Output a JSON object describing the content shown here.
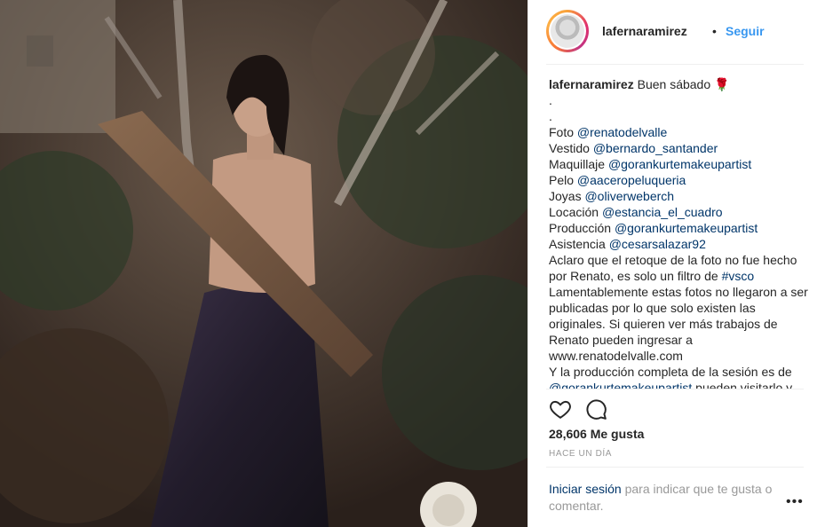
{
  "post": {
    "username": "lafernaramirez",
    "dot": "•",
    "follow_label": "Seguir",
    "caption_first": "Buen sábado 🌹",
    "caption_lines": [
      {
        "plain": ".",
        "mention": ""
      },
      {
        "plain": ".",
        "mention": ""
      },
      {
        "plain": "Foto ",
        "mention": "@renatodelvalle"
      },
      {
        "plain": "Vestido ",
        "mention": "@bernardo_santander"
      },
      {
        "plain": "Maquillaje ",
        "mention": "@gorankurtemakeupartist"
      },
      {
        "plain": "Pelo ",
        "mention": "@aaceropeluqueria"
      },
      {
        "plain": "Joyas ",
        "mention": "@oliverweberch"
      },
      {
        "plain": "Locación ",
        "mention": "@estancia_el_cuadro"
      },
      {
        "plain": "Producción ",
        "mention": "@gorankurtemakeupartist"
      },
      {
        "plain": "Asistencia ",
        "mention": "@cesarsalazar92"
      }
    ],
    "caption_para1": "Aclaro que el retoque de la foto no fue hecho por Renato, es solo un filtro de ",
    "caption_hashtag": "#vsco",
    "caption_para2": "Lamentablemente estas fotos no llegaron a ser publicadas por lo que solo existen las originales. Si quieren ver más trabajos de Renato pueden ingresar a www.renatodelvalle.com",
    "caption_para3": "Y la producción completa de la sesión es de ",
    "caption_para3_mention": "@gorankurtemakeupartist",
    "caption_para3_tail": " pueden visitarlo y",
    "likes": "28,606 Me gusta",
    "time": "HACE UN DÍA",
    "login_link": "Iniciar sesión",
    "login_text": " para indicar que te gusta o comentar.",
    "more_label": "•••"
  },
  "icons": {
    "like": "heart-icon",
    "comment": "comment-icon",
    "more": "more-options-icon"
  },
  "colors": {
    "link": "#3897f0",
    "mention": "#003569",
    "muted": "#999999",
    "text": "#262626"
  }
}
